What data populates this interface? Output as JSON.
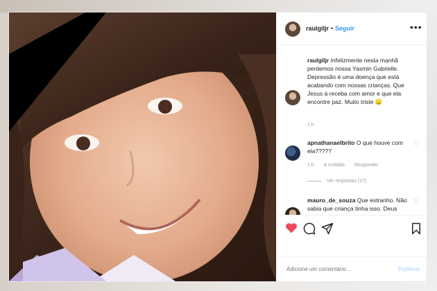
{
  "post": {
    "username": "raulgiljr",
    "separator": "•",
    "follow_label": "Seguir",
    "more_label": "•••"
  },
  "comments": [
    {
      "username": "raulgiljr",
      "text": "Infelizmente nesta manhã perdemos nossa Yasmin Gabrielle. Depressão é uma doença que está acabando com nossas crianças. Que Jesus à receba com amor e que ela encontre paz. Muito triste 😞",
      "time": "1 h"
    },
    {
      "username": "apnathanaelbrito",
      "text": "O que houve com ela?????",
      "time": "1 h",
      "likes": "4 curtidas",
      "reply": "Responder",
      "view_replies": "Ver respostas (17)"
    },
    {
      "username": "mauro_de_souza",
      "text": "Que estranho. Não sabia que criança tinha isso. Deus abençoe a família"
    }
  ],
  "add_comment": {
    "placeholder": "Adicione um comentário...",
    "publish_label": "Publicar"
  },
  "colors": {
    "like_active": "#ed4956",
    "link_blue": "#3897f0",
    "publish_disabled": "#b3dbff"
  },
  "icons": [
    "heart-icon",
    "comment-icon",
    "share-icon",
    "bookmark-icon",
    "more-options-icon",
    "mourning-ribbon"
  ]
}
